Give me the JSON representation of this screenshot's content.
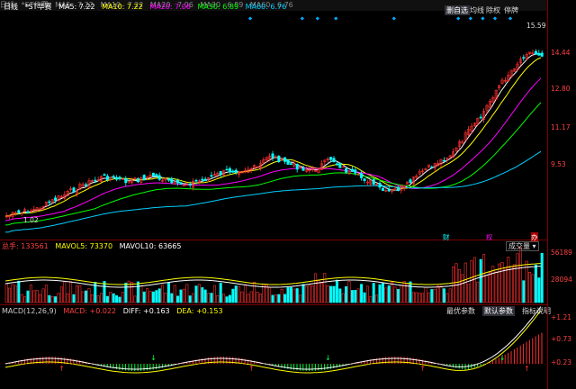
{
  "top_menu": [
    "日线",
    "*ST华赛",
    "MA5",
    "7.22",
    "MA10",
    "7.22",
    "MA20",
    "7.06",
    "MA30",
    "6.89",
    "MA60",
    "6.76"
  ],
  "header": {
    "period": "日线",
    "stock": "*ST华赛",
    "ma": [
      {
        "label": "MA5: 7.22",
        "color": "#ffffff"
      },
      {
        "label": "MA10: 7.22",
        "color": "#ffff00"
      },
      {
        "label": "MA20: 7.06",
        "color": "#ff00ff"
      },
      {
        "label": "MA30: 6.89",
        "color": "#00ff00"
      },
      {
        "label": "MA60: 6.76",
        "color": "#00d0ff"
      }
    ]
  },
  "toolbar": {
    "tabs": [
      "删自选",
      "均线",
      "除权",
      "停牌"
    ],
    "active_tab": "删自选"
  },
  "price_panel": {
    "high_label": "15.59",
    "low_label": "1.02",
    "axis_labels": [
      "14.44",
      "12.80",
      "11.17",
      "9.53"
    ],
    "markers": [
      "财",
      "权",
      "办"
    ]
  },
  "volume_panel": {
    "header": [
      {
        "label": "总手: 133561",
        "color": "#ff4040"
      },
      {
        "label": "MAVOL5: 73370",
        "color": "#ffff00"
      },
      {
        "label": "MAVOL10: 63665",
        "color": "#ffffff"
      }
    ],
    "dropdown": "成交量",
    "axis_labels": [
      "56189",
      "28094"
    ]
  },
  "macd_panel": {
    "header": [
      {
        "label": "MACD(12,26,9)",
        "color": "#cccccc"
      },
      {
        "label": "MACD: +0.022",
        "color": "#ff4040"
      },
      {
        "label": "DIFF: +0.163",
        "color": "#ffffff"
      },
      {
        "label": "DEA: +0.153",
        "color": "#ffff00"
      }
    ],
    "buttons": [
      "最优参数",
      "默认参数",
      "指标说明"
    ],
    "active_button": "默认参数",
    "axis_labels": [
      "+1.21",
      "+0.73",
      "+0.23"
    ]
  },
  "colors": {
    "up": "#ff3030",
    "down": "#00ffff",
    "grid": "#7a0000",
    "ma5": "#ffffff",
    "ma10": "#ffff00",
    "ma20": "#ff00ff",
    "ma30": "#00ff00",
    "ma60": "#00d0ff"
  }
}
